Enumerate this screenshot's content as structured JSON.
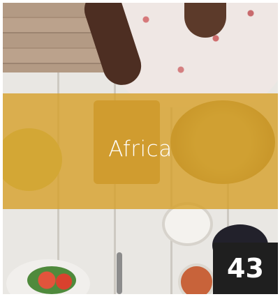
{
  "tile": {
    "title": "Africa",
    "count": "43"
  },
  "colors": {
    "band": "#D6A028",
    "badge": "#1F1F1F",
    "text": "#FFFFFF"
  }
}
